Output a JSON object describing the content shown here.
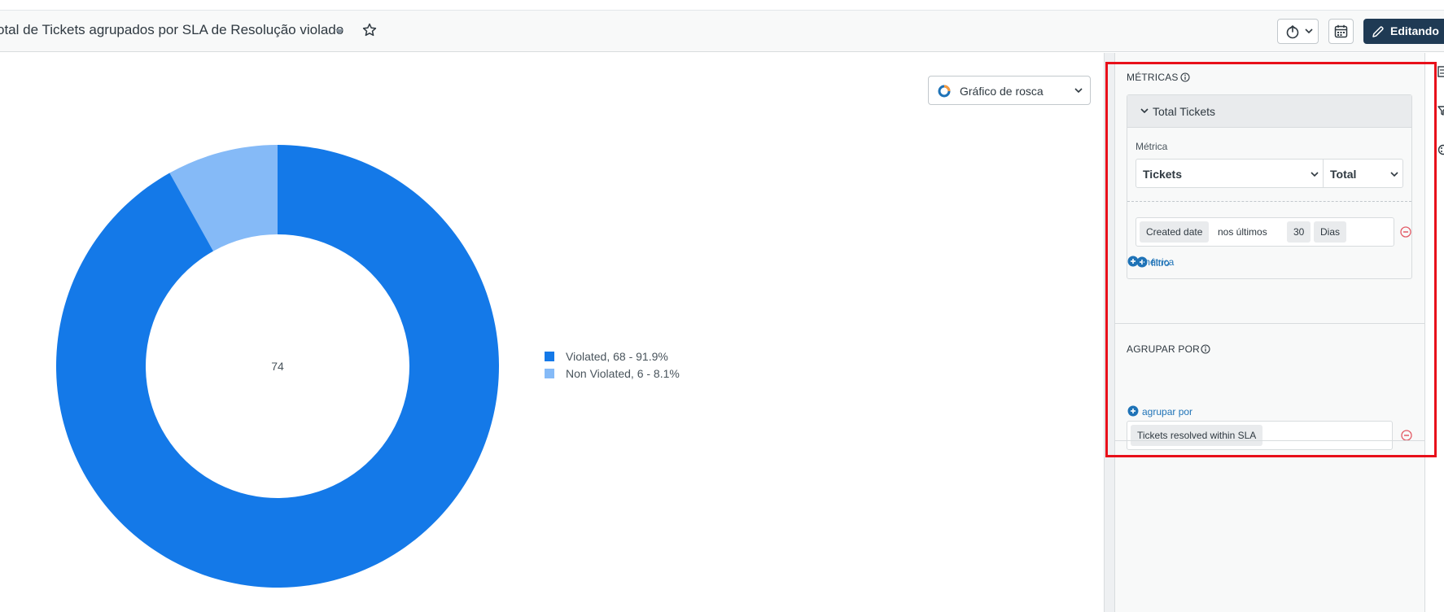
{
  "header": {
    "title": "otal de Tickets agrupados por SLA de Resolução violado",
    "edit_label": "Editando"
  },
  "chart_type_select": {
    "label": "Gráfico de rosca"
  },
  "chart_data": {
    "type": "pie",
    "variant": "donut",
    "center_label": "74",
    "series": [
      {
        "name": "Violated",
        "value": 68,
        "percent": 91.9,
        "color": "#1479e8"
      },
      {
        "name": "Non Violated",
        "value": 6,
        "percent": 8.1,
        "color": "#85baf7"
      }
    ],
    "legend_placement": "right",
    "legend_labels": [
      "Violated,  68 - 91.9%",
      "Non Violated,  6 - 8.1%"
    ]
  },
  "panel": {
    "metrics_label": "MÉTRICAS",
    "metric_card": {
      "title": "Total Tickets",
      "metric_label": "Métrica",
      "metric_value": "Tickets",
      "aggregation_value": "Total",
      "filter": {
        "field": "Created date",
        "operator": "nos últimos",
        "amount": "30",
        "unit": "Dias"
      },
      "add_filter_label": "filtro"
    },
    "add_metric_label": "métrica",
    "group_by_label": "AGRUPAR POR",
    "group_by_value": "Tickets resolved within SLA",
    "add_group_label": "agrupar por"
  },
  "colors": {
    "accent": "#1f73b7",
    "primary_button": "#1f3a54",
    "highlight": "#e8101a",
    "remove": "#e35b66"
  }
}
